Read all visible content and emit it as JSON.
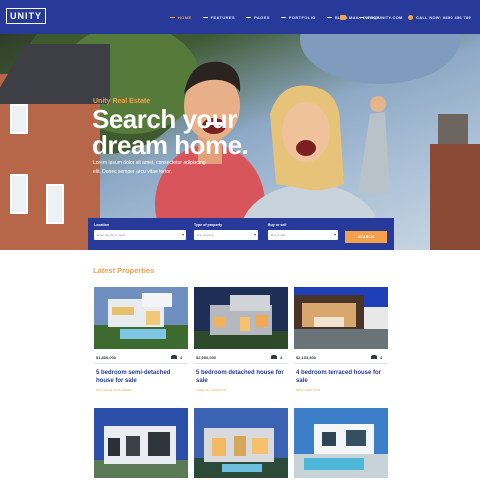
{
  "header": {
    "logo": "UNITY",
    "nav": [
      {
        "label": "HOME",
        "active": true
      },
      {
        "label": "FEATURES",
        "active": false
      },
      {
        "label": "PAGES",
        "active": false
      },
      {
        "label": "PORTFOLIO",
        "active": false
      },
      {
        "label": "BLOG",
        "active": false
      },
      {
        "label": "SHOP",
        "active": false
      }
    ],
    "email": "MAIL: INFO@UNITY.COM",
    "phone": "CALL NOW: 0800 456 789"
  },
  "hero": {
    "kicker": "Unity Real Estate",
    "title": "Search your dream home.",
    "subtitle": "Lorem ipsum dolor sit amet, consectetur adipiscing elit. Donec semper arcu vitae tortor."
  },
  "search": {
    "fields": [
      {
        "label": "Location",
        "value": "Enter the city or area"
      },
      {
        "label": "Type of property",
        "value": "Any property"
      },
      {
        "label": "Buy or sell",
        "value": "Buy or sell"
      }
    ],
    "button": "SEARCH"
  },
  "properties": {
    "title": "Latest Properties",
    "cards": [
      {
        "price": "$1,800,000",
        "count": "4",
        "title": "5 bedroom semi-detached house for sale",
        "meta": "FOR SALE THIS WEEK"
      },
      {
        "price": "$2,950,000",
        "count": "4",
        "title": "5 bedroom detached house for sale",
        "meta": "VIEW ALL PHOTOS"
      },
      {
        "price": "$2,103,800",
        "count": "4",
        "title": "4 bedroom terraced house for sale",
        "meta": "NEW ADDITION"
      }
    ]
  },
  "colors": {
    "brand": "#273a9a",
    "accent": "#f5a04a"
  }
}
